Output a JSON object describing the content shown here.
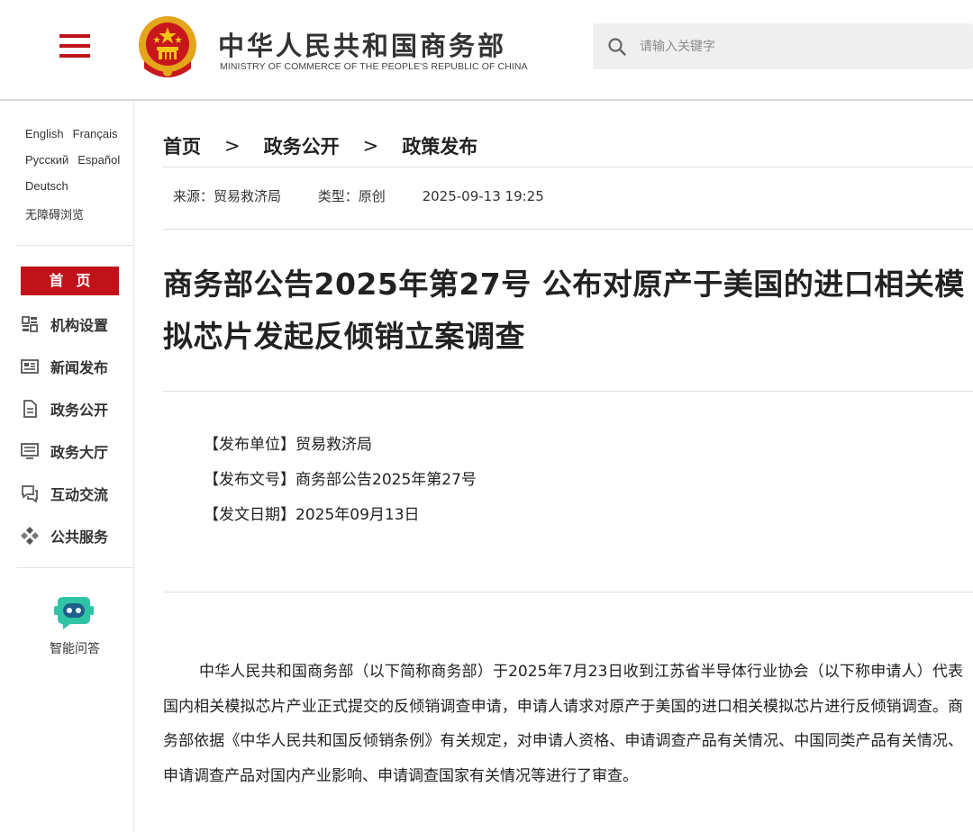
{
  "header": {
    "site_name_cn": "中华人民共和国商务部",
    "site_name_en": "MINISTRY OF COMMERCE OF THE PEOPLE'S REPUBLIC OF CHINA",
    "menu_icon": "hamburger-menu-icon",
    "emblem_icon": "national-emblem-icon",
    "search": {
      "placeholder": "请输入关键字",
      "icon": "search-icon"
    },
    "brand_color": "#c0121b"
  },
  "sidebar": {
    "languages": [
      [
        "English",
        "Français"
      ],
      [
        "Русский",
        "Español"
      ],
      [
        "Deutsch"
      ],
      [
        "无障碍浏览"
      ]
    ],
    "home_label": "首页",
    "nav_items": [
      {
        "label": "机构设置",
        "icon": "org-structure-icon"
      },
      {
        "label": "新闻发布",
        "icon": "news-icon"
      },
      {
        "label": "政务公开",
        "icon": "document-icon"
      },
      {
        "label": "政务大厅",
        "icon": "service-hall-icon"
      },
      {
        "label": "互动交流",
        "icon": "chat-icon"
      },
      {
        "label": "公共服务",
        "icon": "public-service-icon"
      }
    ],
    "ai_assistant": {
      "label": "智能问答",
      "icon": "robot-chat-icon",
      "color": "#2ec4a5"
    }
  },
  "main": {
    "breadcrumb": [
      "首页",
      "政务公开",
      "政策发布"
    ],
    "breadcrumb_separator": ">",
    "meta": {
      "source": "来源：贸易救济局",
      "type": "类型：原创",
      "datetime": "2025-09-13 19:25"
    },
    "title": "商务部公告2025年第27号 公布对原产于美国的进口相关模拟芯片发起反倾销立案调查",
    "info": {
      "unit": "【发布单位】贸易救济局",
      "doc_no": "【发布文号】商务部公告2025年第27号",
      "date": "【发文日期】2025年09月13日"
    },
    "body": "中华人民共和国商务部（以下简称商务部）于2025年7月23日收到江苏省半导体行业协会（以下称申请人）代表国内相关模拟芯片产业正式提交的反倾销调查申请，申请人请求对原产于美国的进口相关模拟芯片进行反倾销调查。商务部依据《中华人民共和国反倾销条例》有关规定，对申请人资格、申请调查产品有关情况、中国同类产品有关情况、申请调查产品对国内产业影响、申请调查国家有关情况等进行了审查。"
  }
}
